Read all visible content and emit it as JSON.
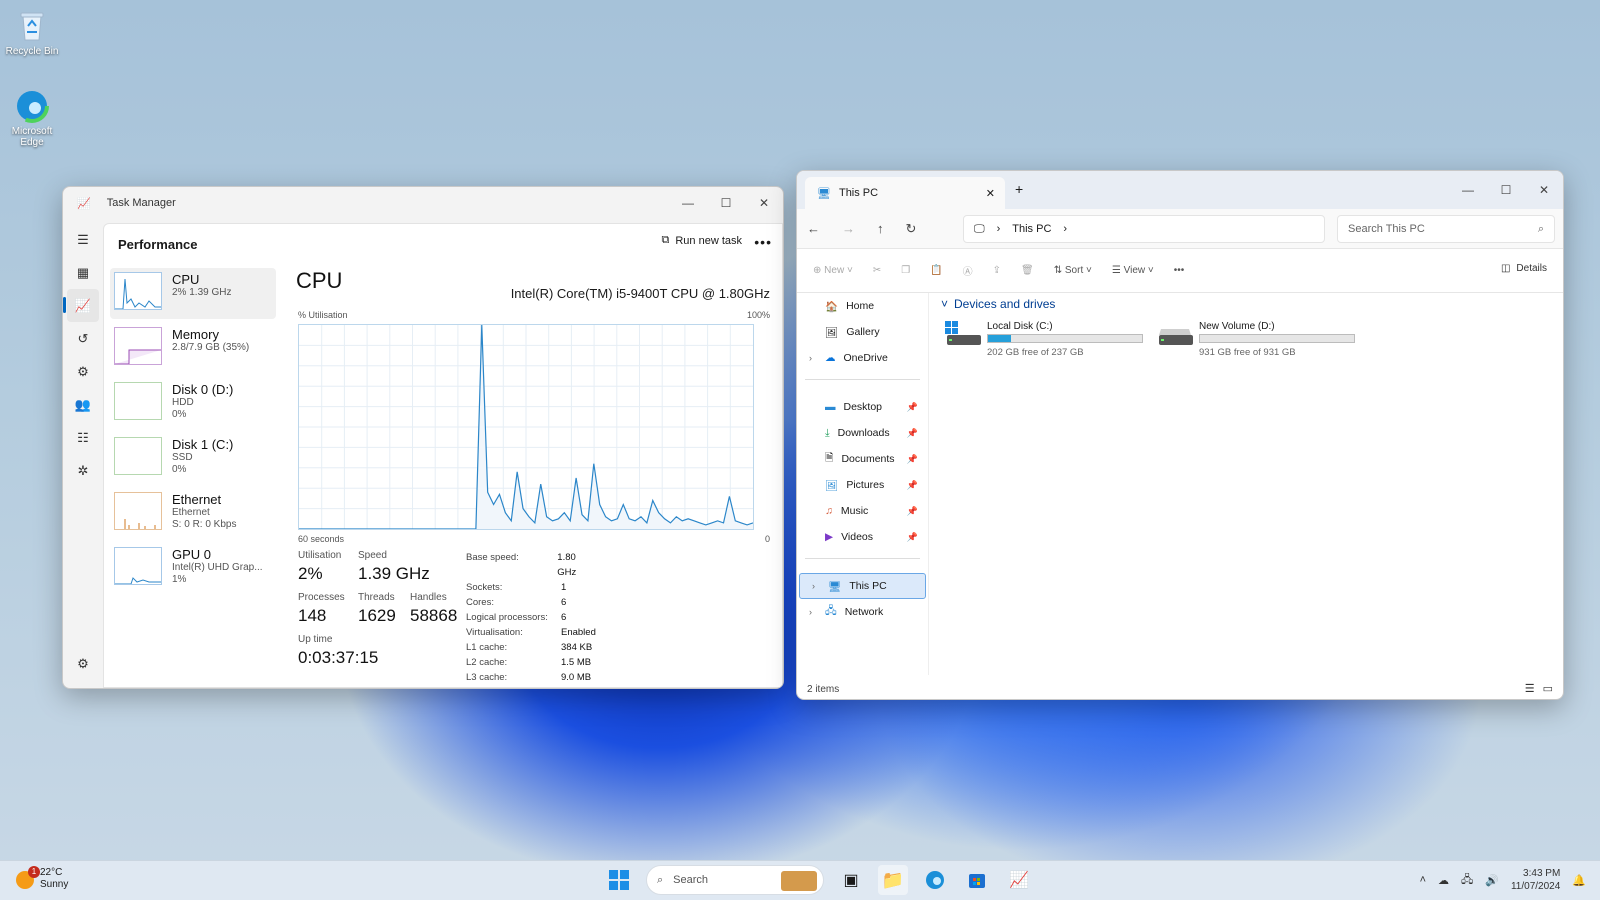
{
  "desktop": {
    "icons": [
      {
        "label": "Recycle Bin"
      },
      {
        "label": "Microsoft Edge"
      }
    ]
  },
  "task_manager": {
    "title": "Task Manager",
    "section": "Performance",
    "run_new_task": "Run new task",
    "resources": [
      {
        "name": "CPU",
        "sub1": "2% 1.39 GHz",
        "sub2": "",
        "sub3": ""
      },
      {
        "name": "Memory",
        "sub1": "2.8/7.9 GB (35%)",
        "sub2": "",
        "sub3": ""
      },
      {
        "name": "Disk 0 (D:)",
        "sub1": "HDD",
        "sub2": "0%",
        "sub3": ""
      },
      {
        "name": "Disk 1 (C:)",
        "sub1": "SSD",
        "sub2": "0%",
        "sub3": ""
      },
      {
        "name": "Ethernet",
        "sub1": "Ethernet",
        "sub2": "S: 0 R: 0 Kbps",
        "sub3": ""
      },
      {
        "name": "GPU 0",
        "sub1": "Intel(R) UHD Grap...",
        "sub2": "1%",
        "sub3": ""
      }
    ],
    "cpu": {
      "heading": "CPU",
      "model": "Intel(R) Core(TM) i5-9400T CPU @ 1.80GHz",
      "ylabel": "% Utilisation",
      "ymax_label": "100%",
      "xlabel": "60 seconds",
      "xmin_label": "0",
      "utilisation_label": "Utilisation",
      "utilisation": "2%",
      "speed_label": "Speed",
      "speed": "1.39 GHz",
      "processes_label": "Processes",
      "processes": "148",
      "threads_label": "Threads",
      "threads": "1629",
      "handles_label": "Handles",
      "handles": "58868",
      "uptime_label": "Up time",
      "uptime": "0:03:37:15",
      "details": [
        {
          "k": "Base speed:",
          "v": "1.80 GHz"
        },
        {
          "k": "Sockets:",
          "v": "1"
        },
        {
          "k": "Cores:",
          "v": "6"
        },
        {
          "k": "Logical processors:",
          "v": "6"
        },
        {
          "k": "Virtualisation:",
          "v": "Enabled"
        },
        {
          "k": "L1 cache:",
          "v": "384 KB"
        },
        {
          "k": "L2 cache:",
          "v": "1.5 MB"
        },
        {
          "k": "L3 cache:",
          "v": "9.0 MB"
        }
      ],
      "history": [
        0,
        0,
        0,
        0,
        0,
        0,
        0,
        0,
        0,
        0,
        0,
        0,
        0,
        0,
        0,
        0,
        0,
        0,
        0,
        0,
        0,
        0,
        0,
        0,
        0,
        0,
        0,
        0,
        0,
        0,
        0,
        100,
        18,
        12,
        17,
        8,
        4,
        28,
        10,
        6,
        3,
        22,
        6,
        4,
        5,
        8,
        4,
        25,
        7,
        4,
        32,
        12,
        6,
        4,
        5,
        12,
        5,
        4,
        6,
        3,
        14,
        8,
        5,
        3,
        6,
        4,
        5,
        4,
        3,
        2,
        3,
        4,
        3,
        16,
        4,
        3,
        2,
        3
      ]
    }
  },
  "explorer": {
    "tab_title": "This PC",
    "breadcrumb": "This PC",
    "search_placeholder": "Search This PC",
    "toolbar": {
      "new": "New",
      "sort": "Sort",
      "view": "View",
      "details": "Details"
    },
    "nav": {
      "home": "Home",
      "gallery": "Gallery",
      "onedrive": "OneDrive",
      "pinned": [
        "Desktop",
        "Downloads",
        "Documents",
        "Pictures",
        "Music",
        "Videos"
      ],
      "thispc": "This PC",
      "network": "Network"
    },
    "group_title": "Devices and drives",
    "drives": [
      {
        "name": "Local Disk (C:)",
        "free": "202 GB free of 237 GB",
        "used_fraction": 0.15
      },
      {
        "name": "New Volume (D:)",
        "free": "931 GB free of 931 GB",
        "used_fraction": 0.0
      }
    ],
    "status": "2 items"
  },
  "taskbar": {
    "temp": "22°C",
    "condition": "Sunny",
    "badge": "1",
    "search": "Search",
    "time": "3:43 PM",
    "date": "11/07/2024"
  }
}
